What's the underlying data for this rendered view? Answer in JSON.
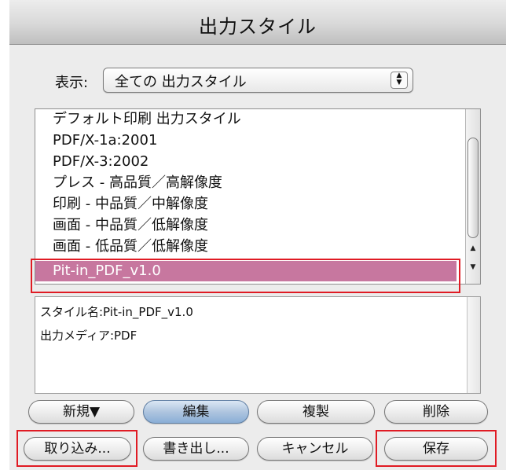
{
  "dialog": {
    "title": "出力スタイル"
  },
  "filter": {
    "label": "表示:",
    "selected": "全ての 出力スタイル",
    "arrows_icon": "up-down-arrows"
  },
  "style_list": {
    "items": [
      "デフォルト印刷 出力スタイル",
      "PDF/X-1a:2001",
      "PDF/X-3:2002",
      "プレス - 高品質／高解像度",
      "印刷 - 中品質／中解像度",
      "画面 - 中品質／低解像度",
      "画面 - 低品質／低解像度",
      "Pit-in_PDF_v1.0"
    ],
    "selected_index": 7,
    "selected_color": "#c7779f"
  },
  "info": {
    "style_name_line": "スタイル名:Pit-in_PDF_v1.0",
    "media_line": "出力メディア:PDF"
  },
  "buttons": {
    "new": "新規▼",
    "edit": "編集",
    "duplicate": "複製",
    "delete": "削除",
    "import": "取り込み...",
    "export": "書き出し...",
    "cancel": "キャンセル",
    "save": "保存"
  },
  "highlight_color": "#e01b24"
}
